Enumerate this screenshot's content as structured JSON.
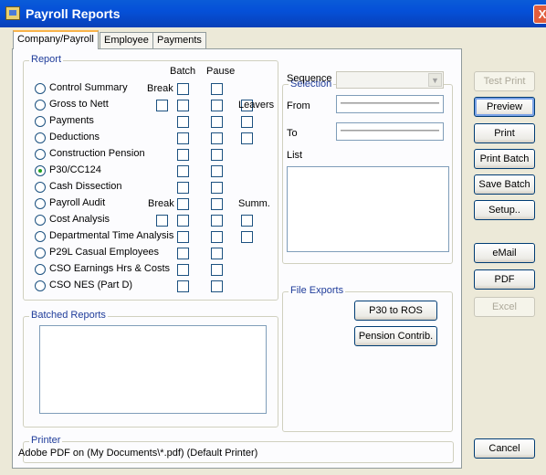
{
  "window": {
    "title": "Payroll Reports",
    "close_glyph": "X"
  },
  "tabs": [
    "Company/Payroll",
    "Employee",
    "Payments"
  ],
  "report": {
    "group_label": "Report",
    "col_batch": "Batch",
    "col_pause": "Pause",
    "items": [
      "Control Summary",
      "Gross to Nett",
      "Payments",
      "Deductions",
      "Construction Pension",
      "P30/CC124",
      "Cash Dissection",
      "Payroll Audit",
      "Cost Analysis",
      "Departmental Time Analysis",
      "P29L Casual Employees",
      "CSO Earnings Hrs & Costs",
      "CSO NES (Part D)"
    ],
    "selected_index": 5,
    "break_label": "Break",
    "leavers_label": "Leavers",
    "summ_label": "Summ."
  },
  "batched": {
    "group_label": "Batched Reports"
  },
  "selection": {
    "group_label": "Selection",
    "sequence_label": "Sequence",
    "from_label": "From",
    "to_label": "To",
    "list_label": "List"
  },
  "file_exports": {
    "group_label": "File Exports",
    "p30_button": "P30 to ROS",
    "pension_button": "Pension Contrib."
  },
  "printer": {
    "group_label": "Printer",
    "value": "Adobe PDF on (My Documents\\*.pdf) (Default Printer)"
  },
  "buttons": {
    "test_print": "Test Print",
    "preview": "Preview",
    "print": "Print",
    "print_batch": "Print Batch",
    "save_batch": "Save Batch",
    "setup": "Setup..",
    "email": "eMail",
    "pdf": "PDF",
    "excel": "Excel",
    "cancel": "Cancel"
  },
  "icons": {
    "title": "payroll-reports-icon",
    "close": "close-icon",
    "dropdown": "chevron-down-icon"
  }
}
